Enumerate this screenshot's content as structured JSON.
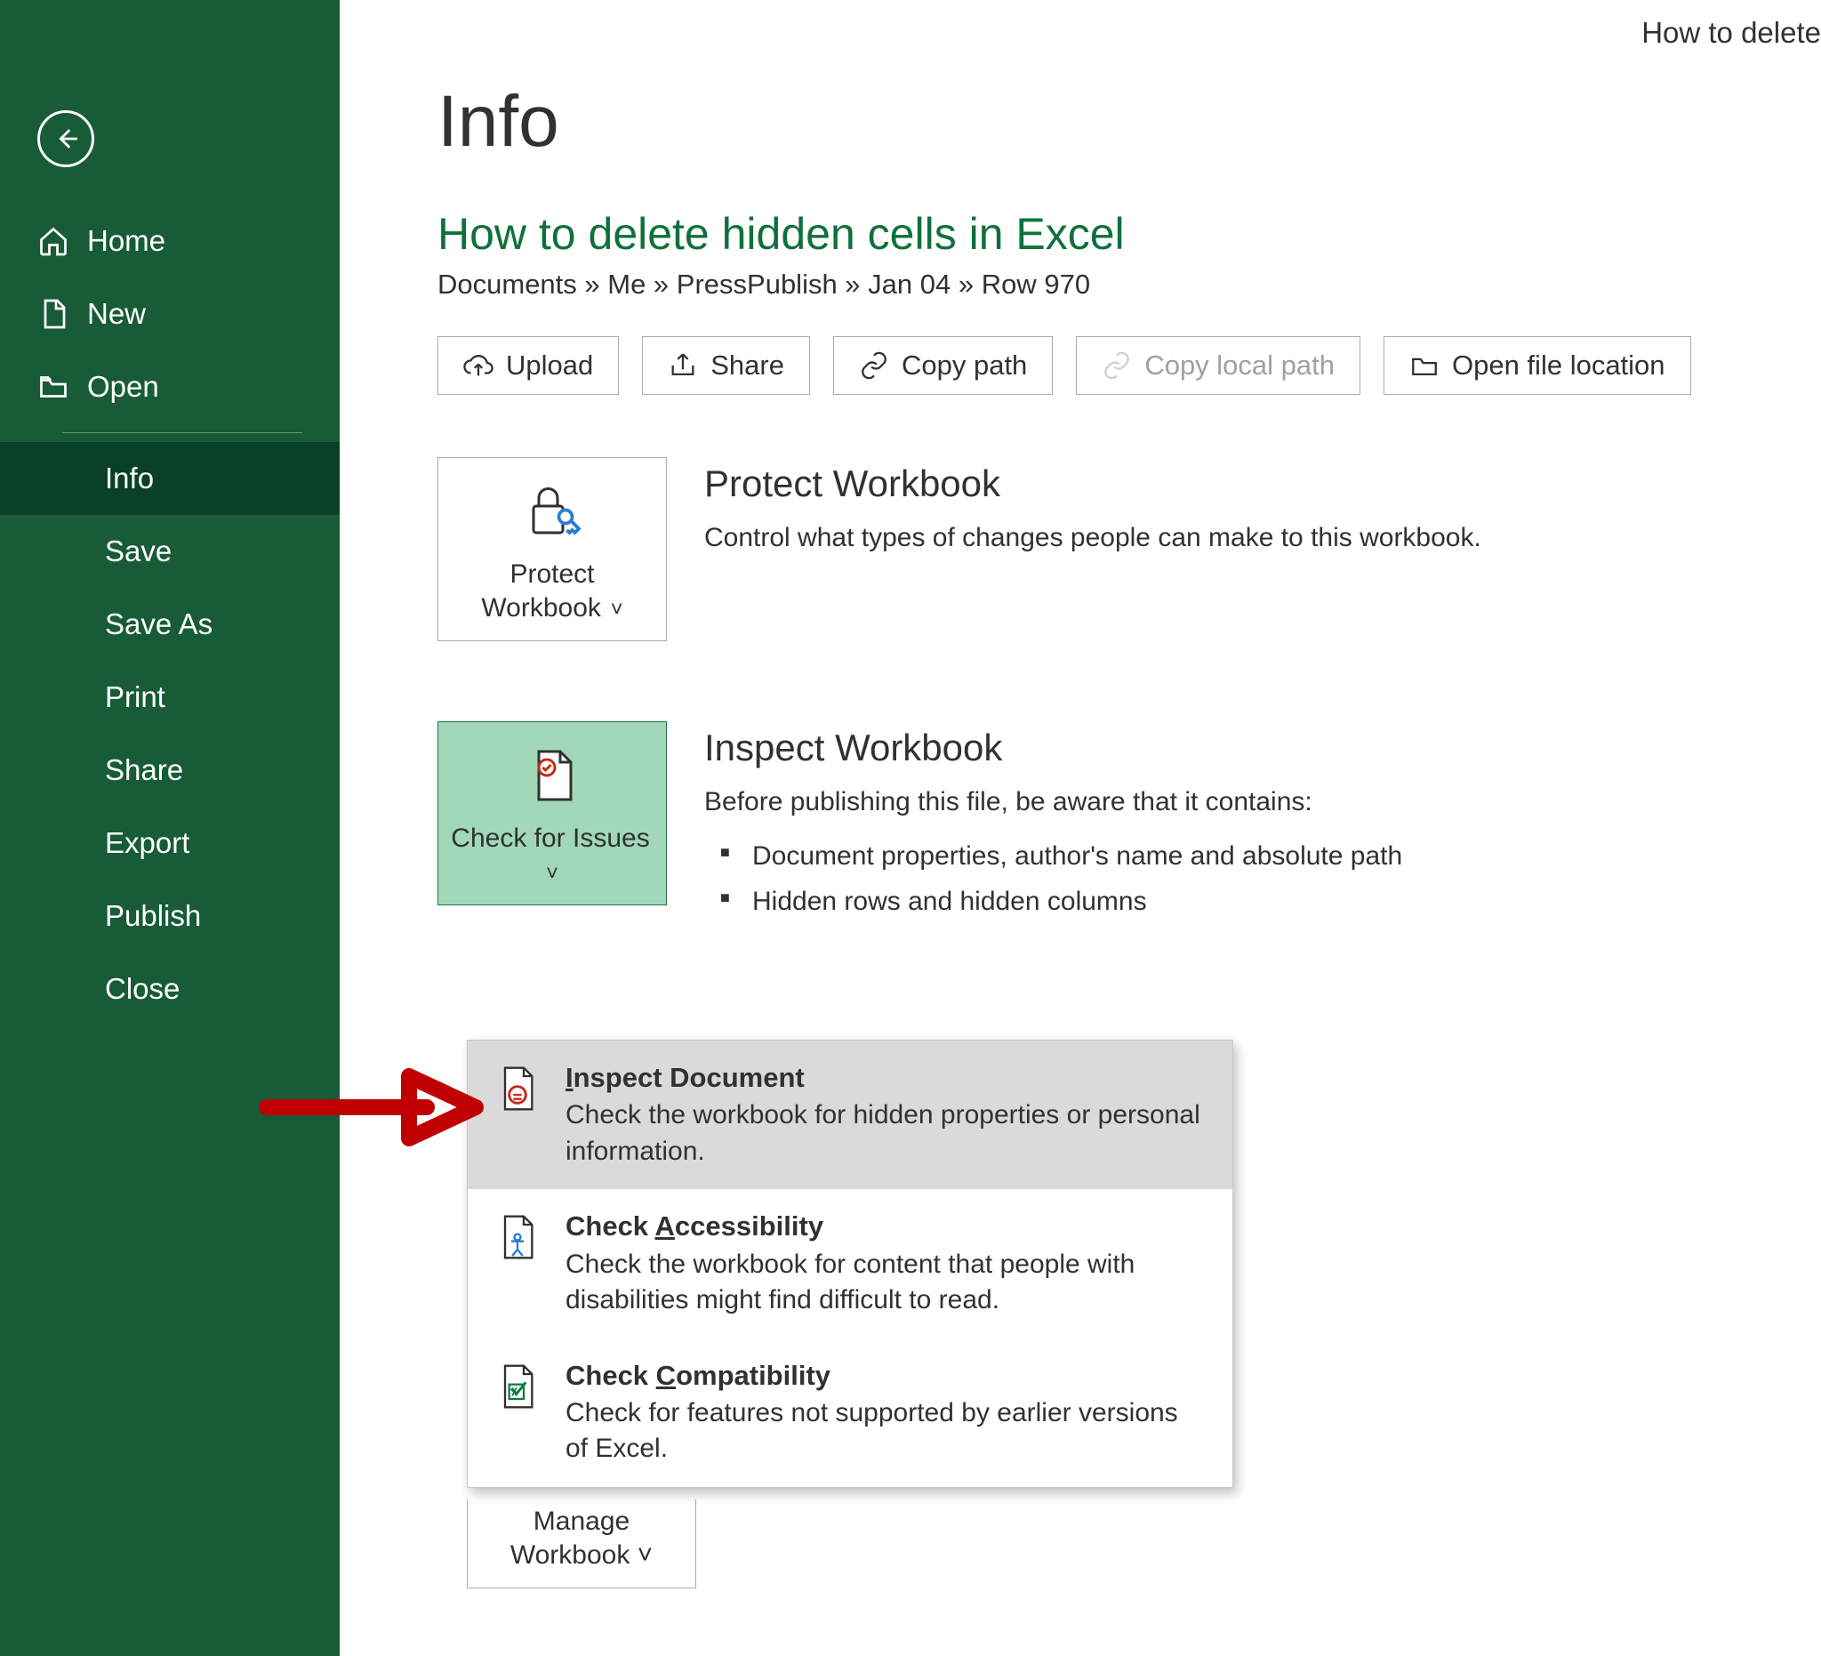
{
  "topRight": "How to delete",
  "sidebar": {
    "items": [
      {
        "label": "Home"
      },
      {
        "label": "New"
      },
      {
        "label": "Open"
      }
    ],
    "sub": [
      {
        "label": "Info",
        "active": true
      },
      {
        "label": "Save"
      },
      {
        "label": "Save As"
      },
      {
        "label": "Print"
      },
      {
        "label": "Share"
      },
      {
        "label": "Export"
      },
      {
        "label": "Publish"
      },
      {
        "label": "Close"
      }
    ]
  },
  "page": {
    "title": "Info",
    "docTitle": "How to delete hidden cells in Excel",
    "breadcrumb": "Documents » Me » PressPublish » Jan 04 » Row 970"
  },
  "toolbar": {
    "upload": "Upload",
    "share": "Share",
    "copyPath": "Copy path",
    "copyLocal": "Copy local path",
    "openLoc": "Open file location"
  },
  "protect": {
    "btn": "Protect Workbook",
    "heading": "Protect Workbook",
    "desc": "Control what types of changes people can make to this workbook."
  },
  "inspect": {
    "btn": "Check for Issues",
    "heading": "Inspect Workbook",
    "desc": "Before publishing this file, be aware that it contains:",
    "bullets": [
      "Document properties, author's name and absolute path",
      "Hidden rows and hidden columns"
    ]
  },
  "dropdown": {
    "items": [
      {
        "titlePre": "I",
        "titleRest": "nspect Document",
        "ul": "I",
        "sub": "Check the workbook for hidden properties or personal information."
      },
      {
        "titlePre": "Check ",
        "titleMid": "A",
        "titleRest": "ccessibility",
        "ul": "A",
        "sub": "Check the workbook for content that people with disabilities might find difficult to read."
      },
      {
        "titlePre": "Check ",
        "titleMid": "C",
        "titleRest": "ompatibility",
        "ul": "C",
        "sub": "Check for features not supported by earlier versions of Excel."
      }
    ]
  },
  "manage": {
    "btn": "Manage Workbook"
  }
}
